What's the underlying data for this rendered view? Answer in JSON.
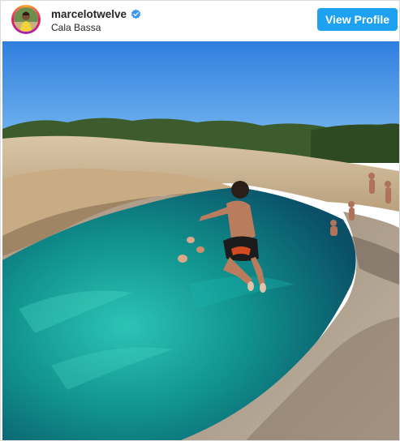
{
  "post": {
    "username": "marcelotwelve",
    "location": "Cala Bassa",
    "view_profile_label": "View Profile"
  },
  "colors": {
    "accent": "#1fa1f1",
    "verified": "#3897f0",
    "sky": "#3f8ee6",
    "water": "#0f8f8c",
    "rock": "#c8b79a"
  },
  "icons": {
    "verified": "verified-badge-icon",
    "avatar": "profile-avatar"
  }
}
